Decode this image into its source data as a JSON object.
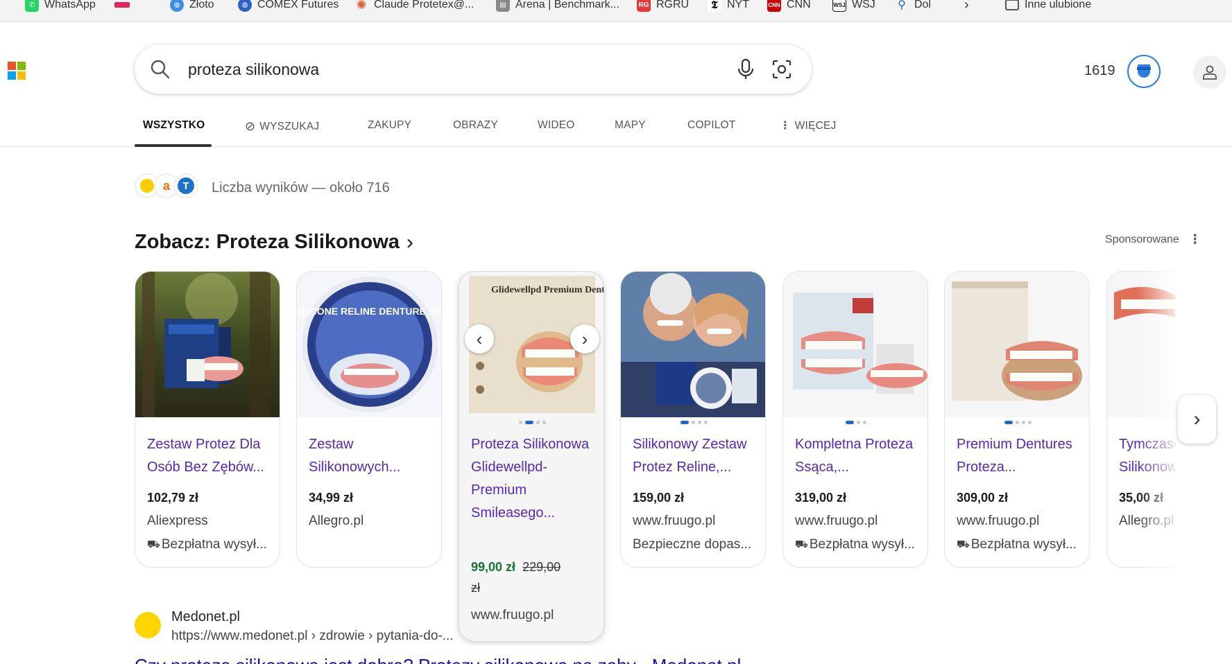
{
  "bookmarks": [
    {
      "label": "WhatsApp",
      "icon": "whatsapp-icon",
      "color": "#25d366"
    },
    {
      "label": "",
      "icon": "site-icon",
      "color": "#e0245e"
    },
    {
      "label": "Złoto",
      "icon": "globe-icon",
      "color": "#3b8ee8"
    },
    {
      "label": "COMEX Futures",
      "icon": "globe-icon",
      "color": "#2a62c9"
    },
    {
      "label": "Claude Protetex@...",
      "icon": "claude-icon",
      "color": "#d9622b"
    },
    {
      "label": "Arena | Benchmark...",
      "icon": "arena-icon",
      "color": "#666666"
    },
    {
      "label": "RGRU",
      "icon": "rg-icon",
      "color": "#e53935"
    },
    {
      "label": "NYT",
      "icon": "nyt-icon",
      "color": "#111111"
    },
    {
      "label": "CNN",
      "icon": "cnn-icon",
      "color": "#cc0000"
    },
    {
      "label": "WSJ",
      "icon": "wsj-icon",
      "color": "#111111"
    },
    {
      "label": "Dol",
      "icon": "search-icon",
      "color": "#1a66d2"
    },
    {
      "label": "Inne ulubione",
      "icon": "folder-icon",
      "color": "#555555"
    }
  ],
  "search": {
    "query": "proteza silikonowa"
  },
  "rewards": {
    "points": "1619"
  },
  "tabs": [
    {
      "label": "WSZYSTKO"
    },
    {
      "label": "WYSZUKAJ"
    },
    {
      "label": "ZAKUPY"
    },
    {
      "label": "OBRAZY"
    },
    {
      "label": "WIDEO"
    },
    {
      "label": "MAPY"
    },
    {
      "label": "COPILOT"
    },
    {
      "label": "WIĘCEJ"
    }
  ],
  "results_count": "Liczba wyników — około 716",
  "shopping": {
    "title": "Zobacz: Proteza Silikonowa",
    "sponsored": "Sponsorowane",
    "products": [
      {
        "title": "Zestaw Protez Dla Osób Bez Zębów...",
        "price": "102,79 zł",
        "store": "Aliexpress",
        "extra": "Bezpłatna wysył..."
      },
      {
        "title": "Zestaw Silikonowych...",
        "price": "34,99 zł",
        "store": "Allegro.pl",
        "extra": ""
      },
      {
        "title": "Proteza Silikonowa Glidewellpd- Premium Smileasego...",
        "price": "99,00 zł",
        "old_price": "229,00",
        "old_currency": "zł",
        "store": "www.fruugo.pl",
        "extra": ""
      },
      {
        "title": "Silikonowy Zestaw Protez Reline,...",
        "price": "159,00 zł",
        "store": "www.fruugo.pl",
        "extra": "Bezpieczne dopas..."
      },
      {
        "title": "Kompletna Proteza Ssąca,...",
        "price": "319,00 zł",
        "store": "www.fruugo.pl",
        "extra": "Bezpłatna wysył..."
      },
      {
        "title": "Premium Dentures Proteza...",
        "price": "309,00 zł",
        "store": "www.fruugo.pl",
        "extra": "Bezpłatna wysył..."
      },
      {
        "title": "Tymczasowa Silikonowa",
        "price": "35,00 zł",
        "store": "Allegro.pl",
        "extra": ""
      }
    ],
    "image_text": {
      "p2": "SILICONE RELINE DENTURE SET",
      "p3_headline": "Glidewellpd Premium Denture Solves It All"
    }
  },
  "result": {
    "site": "Medonet.pl",
    "url": "https://www.medonet.pl › zdrowie › pytania-do-...",
    "title": "Czy proteza silikonowa jest dobra? Protezy silikonowe na zęby - Medonet.pl"
  }
}
